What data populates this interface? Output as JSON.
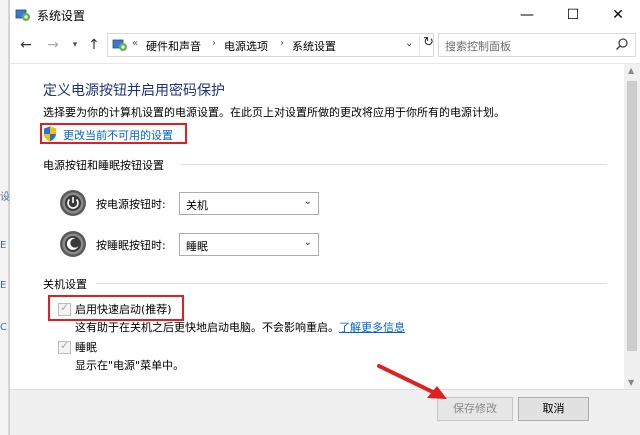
{
  "window": {
    "title": "系统设置",
    "controls": {
      "minimize": "—",
      "maximize": "☐",
      "close": "✕"
    }
  },
  "nav": {
    "back": "←",
    "forward": "→",
    "recent": "▾",
    "up": "↑",
    "breadcrumb": {
      "prefix": "«",
      "items": [
        "硬件和声音",
        "电源选项",
        "系统设置"
      ]
    },
    "search_placeholder": "搜索控制面板"
  },
  "page": {
    "heading": "定义电源按钮并启用密码保护",
    "description": "选择要为你的计算机设置的电源设置。在此页上对设置所做的更改将应用于你所有的电源计划。",
    "change_link": "更改当前不可用的设置"
  },
  "power_buttons": {
    "section_title": "电源按钮和睡眠按钮设置",
    "power_button_label": "按电源按钮时:",
    "power_button_value": "关机",
    "sleep_button_label": "按睡眠按钮时:",
    "sleep_button_value": "睡眠"
  },
  "shutdown": {
    "section_title": "关机设置",
    "fast_startup_label": "启用快速启动(推荐)",
    "fast_startup_help": "这有助于在关机之后更快地启动电脑。不会影响重启。",
    "learn_more": "了解更多信息",
    "sleep_label": "睡眠",
    "sleep_help": "显示在\"电源\"菜单中。"
  },
  "footer": {
    "save_label": "保存修改",
    "cancel_label": "取消"
  },
  "colors": {
    "heading": "#1e3287",
    "link": "#0066cc",
    "highlight": "#e02020"
  },
  "icons": [
    "control-panel-icon",
    "shield-icon",
    "power-icon",
    "sleep-icon",
    "search-icon"
  ]
}
